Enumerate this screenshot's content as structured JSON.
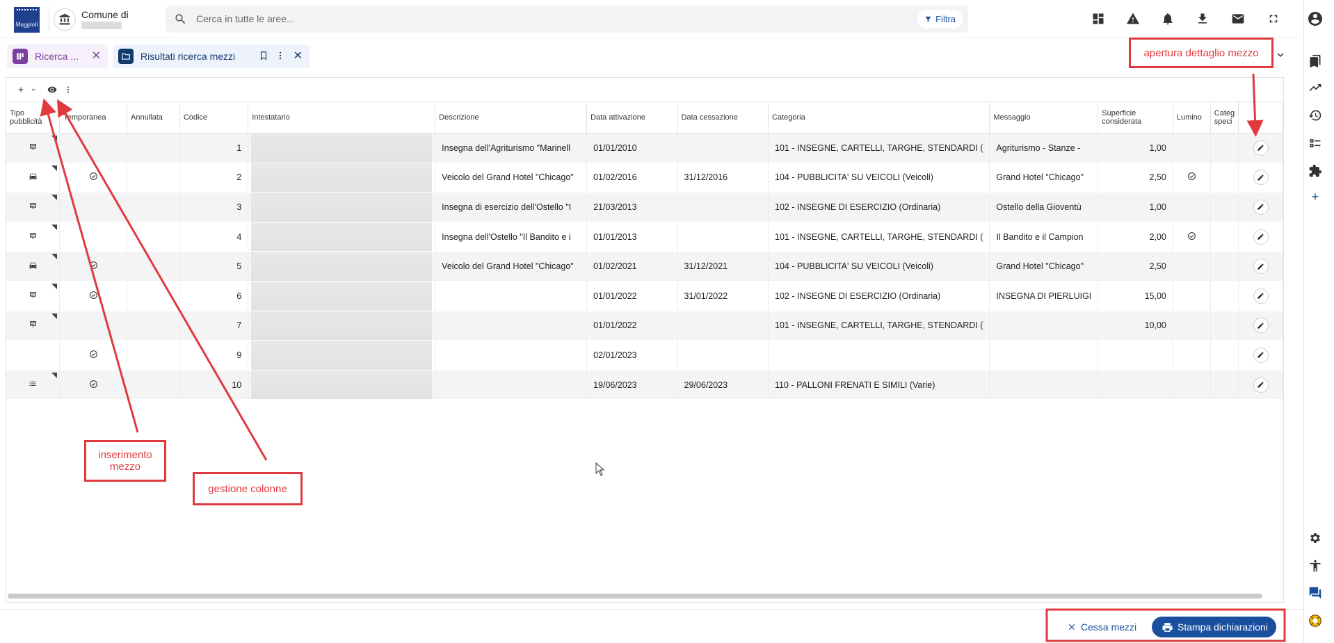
{
  "header": {
    "logo_text": "Maggioli",
    "comune_label": "Comune di",
    "search": {
      "placeholder": "Cerca in tutte le aree..."
    },
    "filter_label": "Filtra"
  },
  "tabs": [
    {
      "label": "Ricerca ...",
      "badge_color": "#7b3fa0"
    },
    {
      "label": "Risultati ricerca mezzi",
      "badge_color": "#123b6d"
    }
  ],
  "grid": {
    "columns": [
      "Tipo pubblicità",
      "Temporanea",
      "Annullata",
      "Codice",
      "Intestatario",
      "Descrizione",
      "Data attivazione",
      "Data cessazione",
      "Categoria",
      "Messaggio",
      "Superficie considerata",
      "Lumino",
      "Categ speci",
      ""
    ],
    "rows": [
      {
        "tipo_icon": "billboard-icon",
        "temporanea": false,
        "codice": "1",
        "descrizione": "Insegna dell'Agriturismo \"Marinell",
        "data_attivazione": "01/01/2010",
        "data_cessazione": "",
        "categoria": "101 - INSEGNE, CARTELLI, TARGHE, STENDARDI (",
        "messaggio": "Agriturismo - Stanze -",
        "superficie": "1,00",
        "luminoso": false
      },
      {
        "tipo_icon": "car-icon",
        "temporanea": true,
        "codice": "2",
        "descrizione": "Veicolo del Grand Hotel \"Chicago\"",
        "data_attivazione": "01/02/2016",
        "data_cessazione": "31/12/2016",
        "categoria": "104 - PUBBLICITA' SU VEICOLI (Veicoli)",
        "messaggio": "Grand Hotel \"Chicago\"",
        "superficie": "2,50",
        "luminoso": true
      },
      {
        "tipo_icon": "billboard-icon",
        "temporanea": false,
        "codice": "3",
        "descrizione": "Insegna di esercizio dell'Ostello \"I",
        "data_attivazione": "21/03/2013",
        "data_cessazione": "",
        "categoria": "102 - INSEGNE DI ESERCIZIO (Ordinaria)",
        "messaggio": "Ostello della Gioventù",
        "superficie": "1,00",
        "luminoso": false
      },
      {
        "tipo_icon": "billboard-icon",
        "temporanea": false,
        "codice": "4",
        "descrizione": "Insegna dell'Ostello \"Il Bandito e i",
        "data_attivazione": "01/01/2013",
        "data_cessazione": "",
        "categoria": "101 - INSEGNE, CARTELLI, TARGHE, STENDARDI (",
        "messaggio": "Il Bandito e il Campion",
        "superficie": "2,00",
        "luminoso": true
      },
      {
        "tipo_icon": "car-icon",
        "temporanea": true,
        "codice": "5",
        "descrizione": "Veicolo del Grand Hotel \"Chicago\"",
        "data_attivazione": "01/02/2021",
        "data_cessazione": "31/12/2021",
        "categoria": "104 - PUBBLICITA' SU VEICOLI (Veicoli)",
        "messaggio": "Grand Hotel \"Chicago\"",
        "superficie": "2,50",
        "luminoso": false
      },
      {
        "tipo_icon": "billboard-icon",
        "temporanea": true,
        "codice": "6",
        "descrizione": "",
        "data_attivazione": "01/01/2022",
        "data_cessazione": "31/01/2022",
        "categoria": "102 - INSEGNE DI ESERCIZIO (Ordinaria)",
        "messaggio": "INSEGNA DI PIERLUIGI",
        "superficie": "15,00",
        "luminoso": false
      },
      {
        "tipo_icon": "billboard-icon",
        "temporanea": false,
        "codice": "7",
        "descrizione": "",
        "data_attivazione": "01/01/2022",
        "data_cessazione": "",
        "categoria": "101 - INSEGNE, CARTELLI, TARGHE, STENDARDI (",
        "messaggio": "",
        "superficie": "10,00",
        "luminoso": false
      },
      {
        "tipo_icon": "",
        "temporanea": true,
        "codice": "9",
        "descrizione": "",
        "data_attivazione": "02/01/2023",
        "data_cessazione": "",
        "categoria": "",
        "messaggio": "",
        "superficie": "",
        "luminoso": false
      },
      {
        "tipo_icon": "list-icon",
        "temporanea": true,
        "codice": "10",
        "descrizione": "",
        "data_attivazione": "19/06/2023",
        "data_cessazione": "29/06/2023",
        "categoria": "110 - PALLONI FRENATI E SIMILI (Varie)",
        "messaggio": "",
        "superficie": "",
        "luminoso": false
      }
    ]
  },
  "footer": {
    "cessa_label": "Cessa mezzi",
    "stampa_label": "Stampa dichiarazioni"
  },
  "annotations": {
    "dettaglio": "apertura dettaglio mezzo",
    "inserimento": "inserimento mezzo",
    "colonne": "gestione colonne"
  },
  "colors": {
    "primary": "#1a4fa0",
    "annotation": "#e0393e"
  }
}
